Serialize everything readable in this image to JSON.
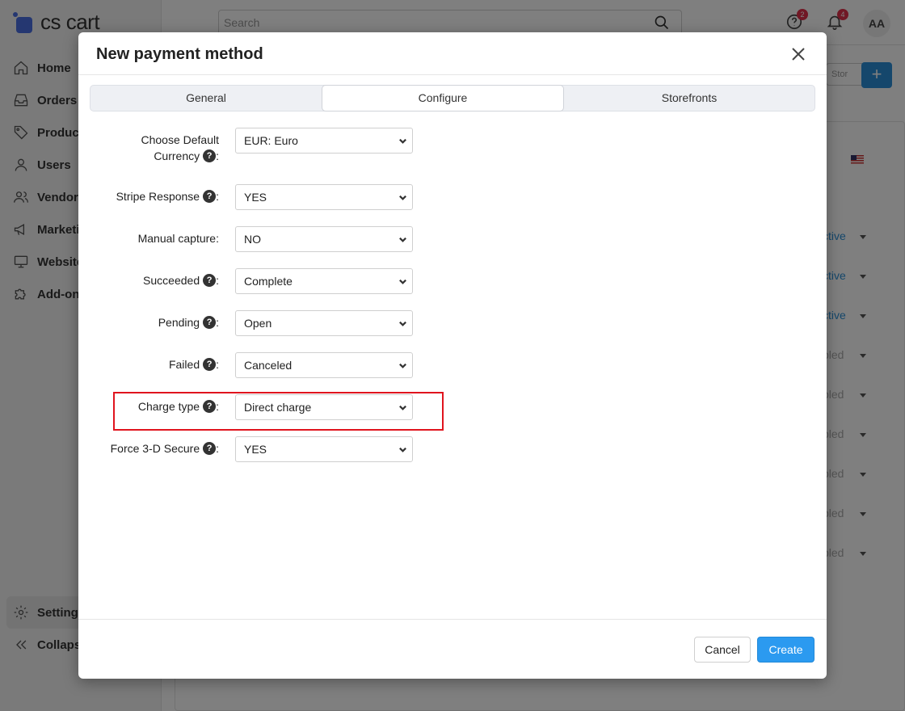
{
  "background": {
    "brand": "cs cart",
    "search_placeholder": "Search",
    "notifications": {
      "help_count": "2",
      "bell_count": "4"
    },
    "avatar_initials": "AA",
    "nav": [
      {
        "label": "Home",
        "icon": "home-icon"
      },
      {
        "label": "Orders",
        "icon": "inbox-icon"
      },
      {
        "label": "Products",
        "icon": "tag-icon"
      },
      {
        "label": "Users",
        "icon": "user-icon"
      },
      {
        "label": "Vendors",
        "icon": "users-icon"
      },
      {
        "label": "Marketing",
        "icon": "megaphone-icon"
      },
      {
        "label": "Website",
        "icon": "monitor-icon"
      },
      {
        "label": "Add-ons",
        "icon": "puzzle-icon"
      }
    ],
    "nav_bottom": [
      {
        "label": "Settings",
        "icon": "gear-icon"
      },
      {
        "label": "Collapse",
        "icon": "chevrons-left-icon"
      }
    ],
    "store_button": "Stor",
    "add_button": "+",
    "statuses": [
      "ctive",
      "ctive",
      "ctive",
      "bled",
      "bled",
      "bled",
      "bled",
      "bled",
      "bled"
    ]
  },
  "modal": {
    "title": "New payment method",
    "tabs": [
      {
        "label": "General",
        "active": false
      },
      {
        "label": "Configure",
        "active": true
      },
      {
        "label": "Storefronts",
        "active": false
      }
    ],
    "fields": [
      {
        "label": "Choose Default Currency",
        "help": true,
        "value": "EUR: Euro"
      },
      {
        "label": "Stripe Response",
        "help": true,
        "value": "YES"
      },
      {
        "label": "Manual capture:",
        "help": false,
        "value": "NO"
      },
      {
        "label": "Succeeded",
        "help": true,
        "value": "Complete"
      },
      {
        "label": "Pending",
        "help": true,
        "value": "Open"
      },
      {
        "label": "Failed",
        "help": true,
        "value": "Canceled"
      },
      {
        "label": "Charge type",
        "help": true,
        "value": "Direct charge",
        "highlighted": true
      },
      {
        "label": "Force 3-D Secure",
        "help": true,
        "value": "YES"
      }
    ],
    "buttons": {
      "cancel": "Cancel",
      "create": "Create"
    }
  },
  "colors": {
    "primary": "#2b9af0",
    "highlight": "#e0141e",
    "link": "#2a8fd6"
  }
}
